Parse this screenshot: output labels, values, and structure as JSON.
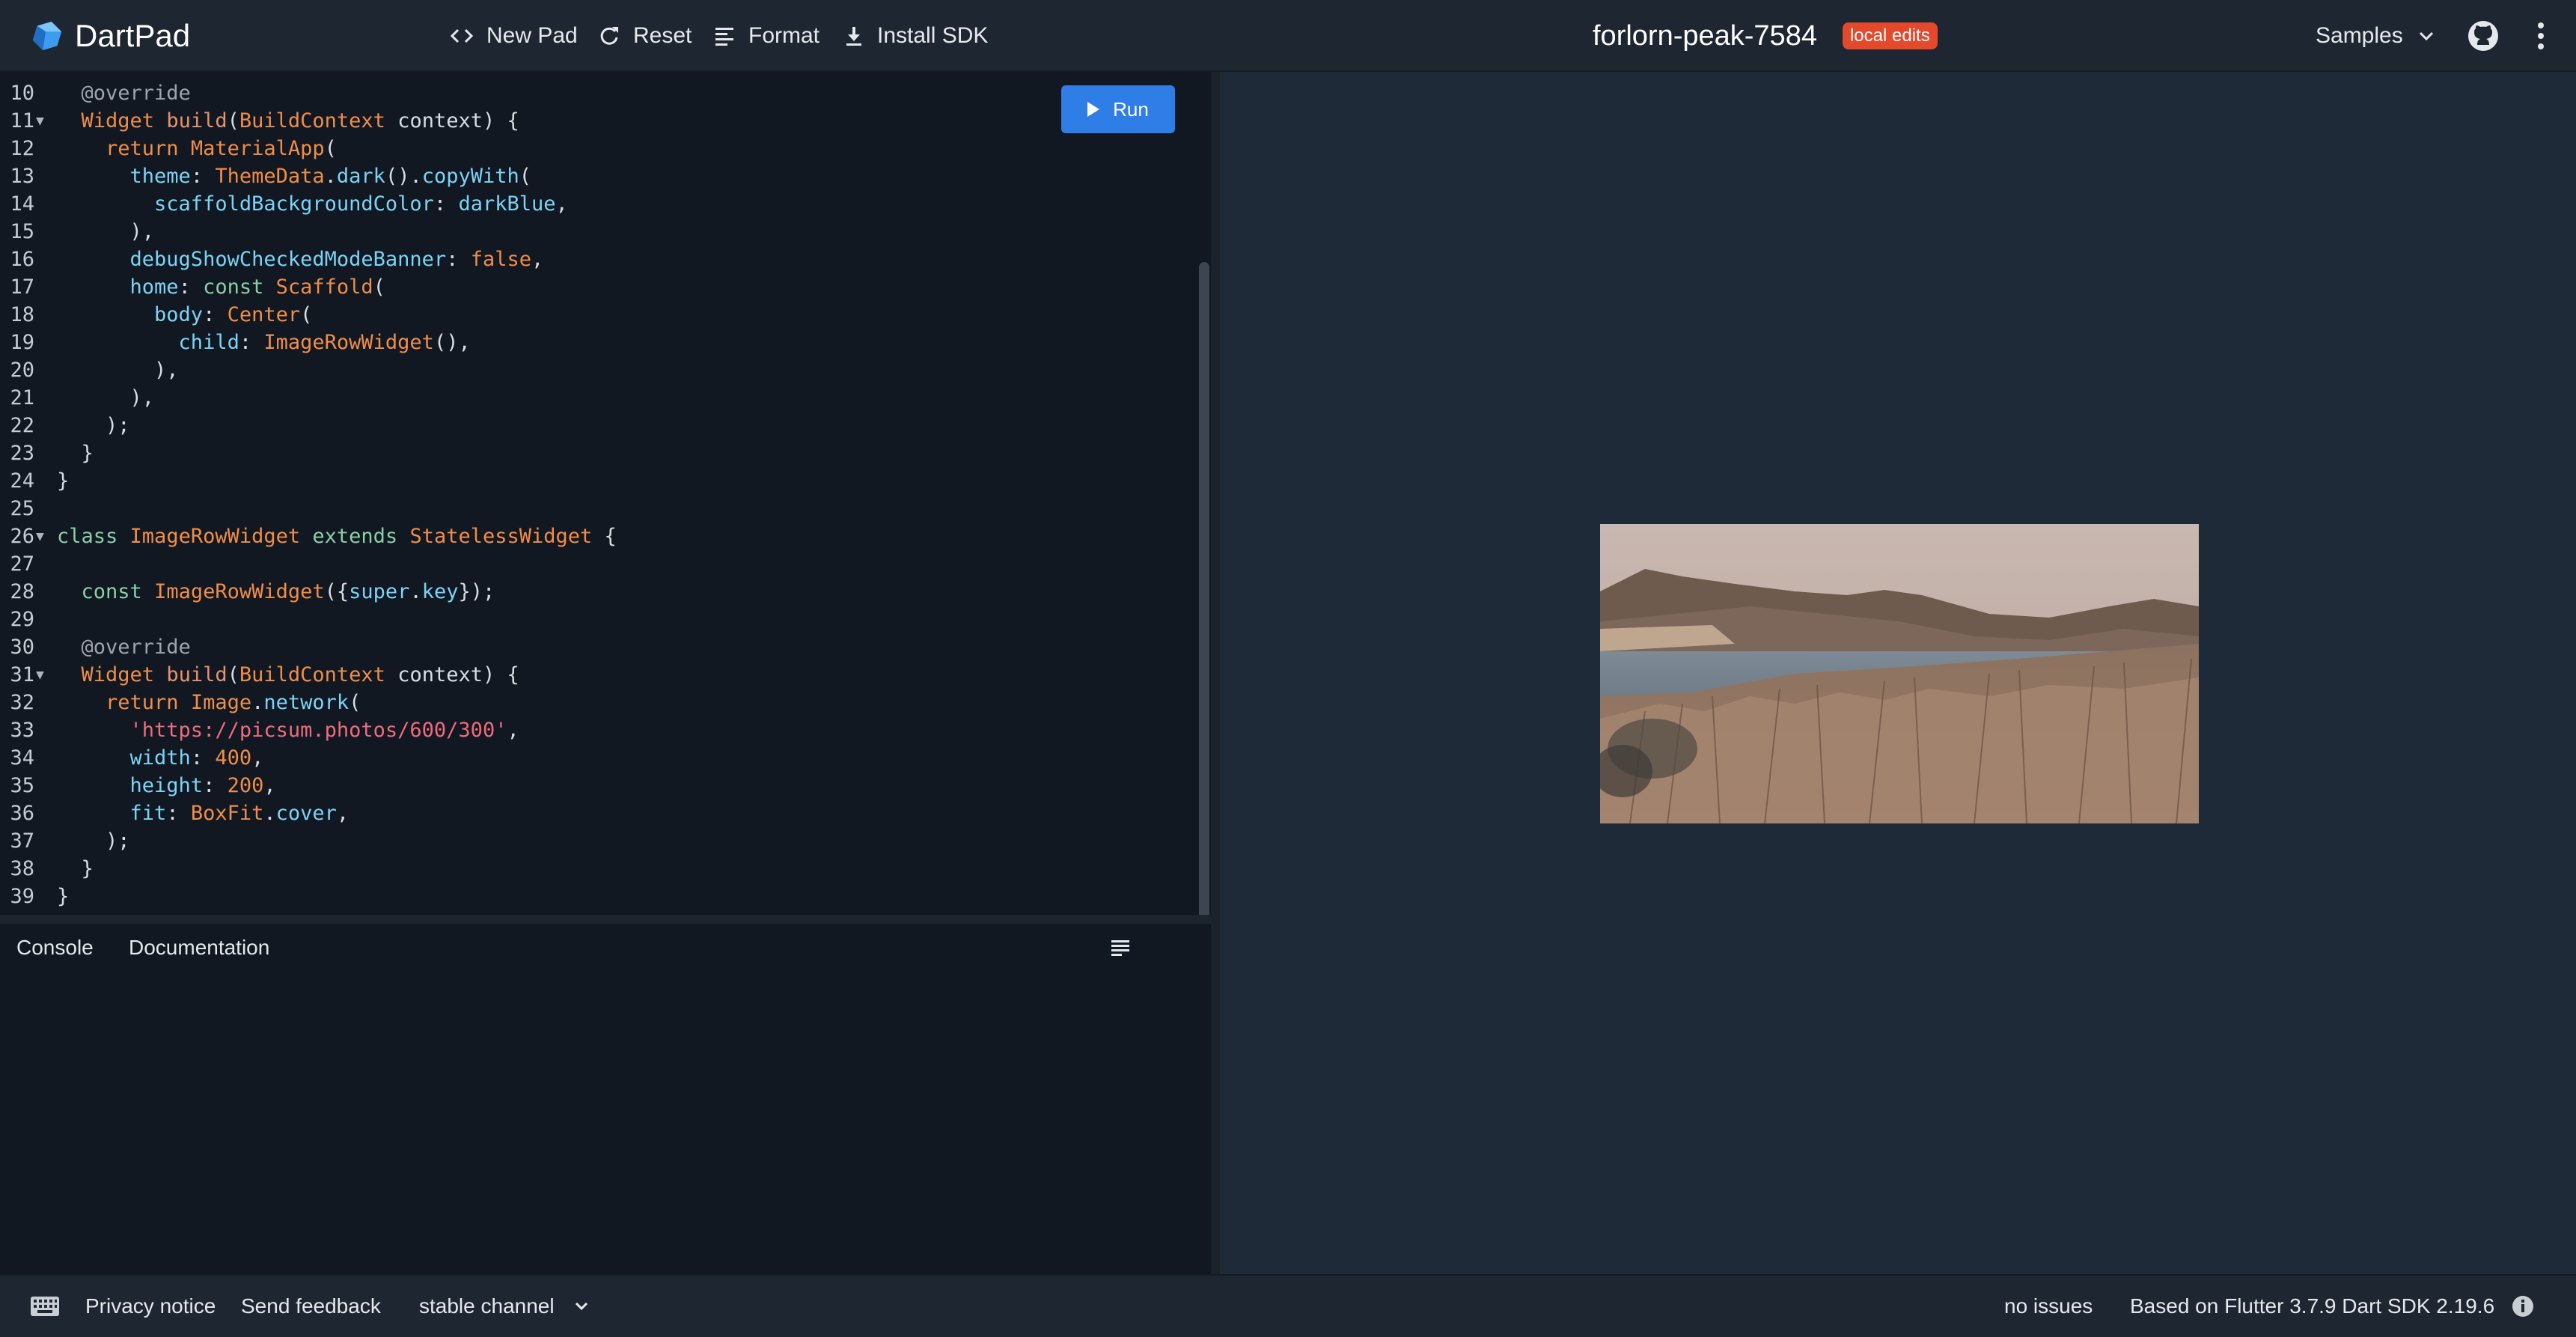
{
  "header": {
    "brand": "DartPad",
    "toolbar": {
      "new_pad": "New Pad",
      "reset": "Reset",
      "format": "Format",
      "install_sdk": "Install SDK"
    },
    "pad_title": "forlorn-peak-7584",
    "status_badge": "local edits",
    "samples": "Samples"
  },
  "editor": {
    "run_label": "Run",
    "lines": [
      {
        "n": "10",
        "fold": false,
        "tokens": [
          [
            "ann",
            "  @override"
          ]
        ]
      },
      {
        "n": "11",
        "fold": true,
        "tokens": [
          [
            "ty",
            "  Widget"
          ],
          [
            "pl",
            " "
          ],
          [
            "fn",
            "build"
          ],
          [
            "pl",
            "("
          ],
          [
            "ty",
            "BuildContext"
          ],
          [
            "pl",
            " context) {"
          ]
        ]
      },
      {
        "n": "12",
        "fold": false,
        "tokens": [
          [
            "kw",
            "    return"
          ],
          [
            "pl",
            " "
          ],
          [
            "cls",
            "MaterialApp"
          ],
          [
            "pl",
            "("
          ]
        ]
      },
      {
        "n": "13",
        "fold": false,
        "tokens": [
          [
            "pr",
            "      theme"
          ],
          [
            "pl",
            ": "
          ],
          [
            "cls",
            "ThemeData"
          ],
          [
            "pl",
            "."
          ],
          [
            "pr",
            "dark"
          ],
          [
            "pl",
            "()."
          ],
          [
            "pr",
            "copyWith"
          ],
          [
            "pl",
            "("
          ]
        ]
      },
      {
        "n": "14",
        "fold": false,
        "tokens": [
          [
            "pr",
            "        scaffoldBackgroundColor"
          ],
          [
            "pl",
            ": "
          ],
          [
            "pr",
            "darkBlue"
          ],
          [
            "pl",
            ","
          ]
        ]
      },
      {
        "n": "15",
        "fold": false,
        "tokens": [
          [
            "pl",
            "      ),"
          ]
        ]
      },
      {
        "n": "16",
        "fold": false,
        "tokens": [
          [
            "pr",
            "      debugShowCheckedModeBanner"
          ],
          [
            "pl",
            ": "
          ],
          [
            "kw",
            "false"
          ],
          [
            "pl",
            ","
          ]
        ]
      },
      {
        "n": "17",
        "fold": false,
        "tokens": [
          [
            "pr",
            "      home"
          ],
          [
            "pl",
            ": "
          ],
          [
            "kw2",
            "const"
          ],
          [
            "pl",
            " "
          ],
          [
            "cls",
            "Scaffold"
          ],
          [
            "pl",
            "("
          ]
        ]
      },
      {
        "n": "18",
        "fold": false,
        "tokens": [
          [
            "pr",
            "        body"
          ],
          [
            "pl",
            ": "
          ],
          [
            "cls",
            "Center"
          ],
          [
            "pl",
            "("
          ]
        ]
      },
      {
        "n": "19",
        "fold": false,
        "tokens": [
          [
            "pr",
            "          child"
          ],
          [
            "pl",
            ": "
          ],
          [
            "cls",
            "ImageRowWidget"
          ],
          [
            "pl",
            "(),"
          ]
        ]
      },
      {
        "n": "20",
        "fold": false,
        "tokens": [
          [
            "pl",
            "        ),"
          ]
        ]
      },
      {
        "n": "21",
        "fold": false,
        "tokens": [
          [
            "pl",
            "      ),"
          ]
        ]
      },
      {
        "n": "22",
        "fold": false,
        "tokens": [
          [
            "pl",
            "    );"
          ]
        ]
      },
      {
        "n": "23",
        "fold": false,
        "tokens": [
          [
            "pl",
            "  }"
          ]
        ]
      },
      {
        "n": "24",
        "fold": false,
        "tokens": [
          [
            "pl",
            "}"
          ]
        ]
      },
      {
        "n": "25",
        "fold": false,
        "tokens": [
          [
            "pl",
            ""
          ]
        ]
      },
      {
        "n": "26",
        "fold": true,
        "tokens": [
          [
            "kw2",
            "class"
          ],
          [
            "pl",
            " "
          ],
          [
            "cls",
            "ImageRowWidget"
          ],
          [
            "pl",
            " "
          ],
          [
            "kw2",
            "extends"
          ],
          [
            "pl",
            " "
          ],
          [
            "cls",
            "StatelessWidget"
          ],
          [
            "pl",
            " {"
          ]
        ]
      },
      {
        "n": "27",
        "fold": false,
        "tokens": [
          [
            "pl",
            ""
          ]
        ]
      },
      {
        "n": "28",
        "fold": false,
        "tokens": [
          [
            "kw2",
            "  const"
          ],
          [
            "pl",
            " "
          ],
          [
            "cls",
            "ImageRowWidget"
          ],
          [
            "pl",
            "({"
          ],
          [
            "pr",
            "super"
          ],
          [
            "pl",
            "."
          ],
          [
            "pr",
            "key"
          ],
          [
            "pl",
            "});"
          ]
        ]
      },
      {
        "n": "29",
        "fold": false,
        "tokens": [
          [
            "pl",
            ""
          ]
        ]
      },
      {
        "n": "30",
        "fold": false,
        "tokens": [
          [
            "ann",
            "  @override"
          ]
        ]
      },
      {
        "n": "31",
        "fold": true,
        "tokens": [
          [
            "ty",
            "  Widget"
          ],
          [
            "pl",
            " "
          ],
          [
            "fn",
            "build"
          ],
          [
            "pl",
            "("
          ],
          [
            "ty",
            "BuildContext"
          ],
          [
            "pl",
            " context) {"
          ]
        ]
      },
      {
        "n": "32",
        "fold": false,
        "tokens": [
          [
            "kw",
            "    return"
          ],
          [
            "pl",
            " "
          ],
          [
            "cls",
            "Image"
          ],
          [
            "pl",
            "."
          ],
          [
            "pr",
            "network"
          ],
          [
            "pl",
            "("
          ]
        ]
      },
      {
        "n": "33",
        "fold": false,
        "tokens": [
          [
            "str",
            "      'https://picsum.photos/600/300'"
          ],
          [
            "pl",
            ","
          ]
        ]
      },
      {
        "n": "34",
        "fold": false,
        "tokens": [
          [
            "pr",
            "      width"
          ],
          [
            "pl",
            ": "
          ],
          [
            "num",
            "400"
          ],
          [
            "pl",
            ","
          ]
        ]
      },
      {
        "n": "35",
        "fold": false,
        "tokens": [
          [
            "pr",
            "      height"
          ],
          [
            "pl",
            ": "
          ],
          [
            "num",
            "200"
          ],
          [
            "pl",
            ","
          ]
        ]
      },
      {
        "n": "36",
        "fold": false,
        "tokens": [
          [
            "pr",
            "      fit"
          ],
          [
            "pl",
            ": "
          ],
          [
            "cls",
            "BoxFit"
          ],
          [
            "pl",
            "."
          ],
          [
            "pr",
            "cover"
          ],
          [
            "pl",
            ","
          ]
        ]
      },
      {
        "n": "37",
        "fold": false,
        "tokens": [
          [
            "pl",
            "    );"
          ]
        ]
      },
      {
        "n": "38",
        "fold": false,
        "tokens": [
          [
            "pl",
            "  }"
          ]
        ]
      },
      {
        "n": "39",
        "fold": false,
        "tokens": [
          [
            "pl",
            "}"
          ]
        ]
      }
    ]
  },
  "console": {
    "tabs": [
      "Console",
      "Documentation"
    ]
  },
  "footer": {
    "privacy": "Privacy notice",
    "feedback": "Send feedback",
    "channel": "stable channel",
    "issues": "no issues",
    "version": "Based on Flutter 3.7.9 Dart SDK 2.19.6"
  },
  "icons": {
    "logo": "dart-logo-icon",
    "new_pad": "code-brackets-icon",
    "reset": "refresh-icon",
    "format": "format-lines-icon",
    "install_sdk": "download-icon",
    "samples": "chevron-down-icon",
    "github": "github-icon",
    "menu": "more-vert-icon",
    "run": "play-icon",
    "console_clear": "clear-console-icon",
    "keyboard": "keyboard-icon",
    "channel": "chevron-down-icon",
    "info": "info-icon"
  },
  "colors": {
    "accent": "#2f7de6",
    "badge": "#e5492b",
    "editor_bg": "#111822",
    "output_bg": "#1f2a38"
  }
}
